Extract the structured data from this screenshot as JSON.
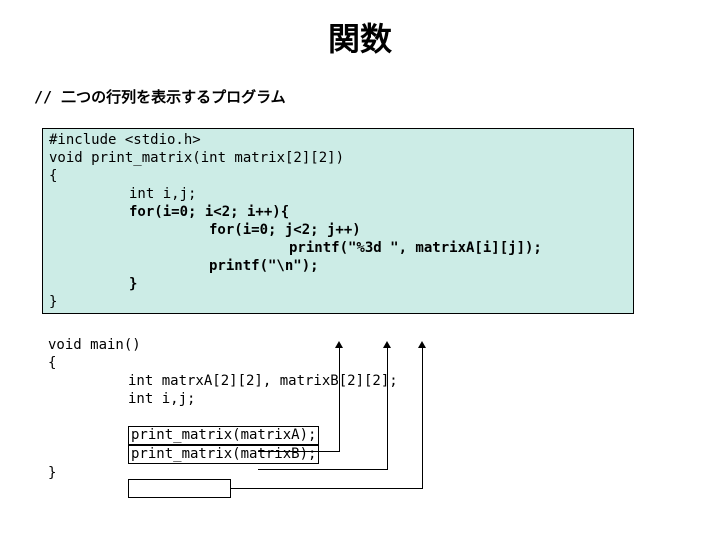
{
  "title": "関数",
  "subtitle": "// 二つの行列を表示するプログラム",
  "code": {
    "l1": "#include <stdio.h>",
    "l2": "void print_matrix(int matrix[2][2])",
    "l3": "{",
    "l4": "int i,j;",
    "l5": "for(i=0; i<2; i++){",
    "l6": "for(i=0; j<2; j++)",
    "l7": "printf(\"%3d \", matrixA[i][j]);",
    "l8": "printf(\"\\n\");",
    "l9": "}",
    "l10": "}"
  },
  "main": {
    "l1": "void main()",
    "l2": "{",
    "l3": "int matrxA[2][2], matrixB[2][2];",
    "l4": "int i,j;",
    "l5": "print_matrix(matrixA);",
    "l6": "print_matrix(matrixB);",
    "l7": "}"
  }
}
